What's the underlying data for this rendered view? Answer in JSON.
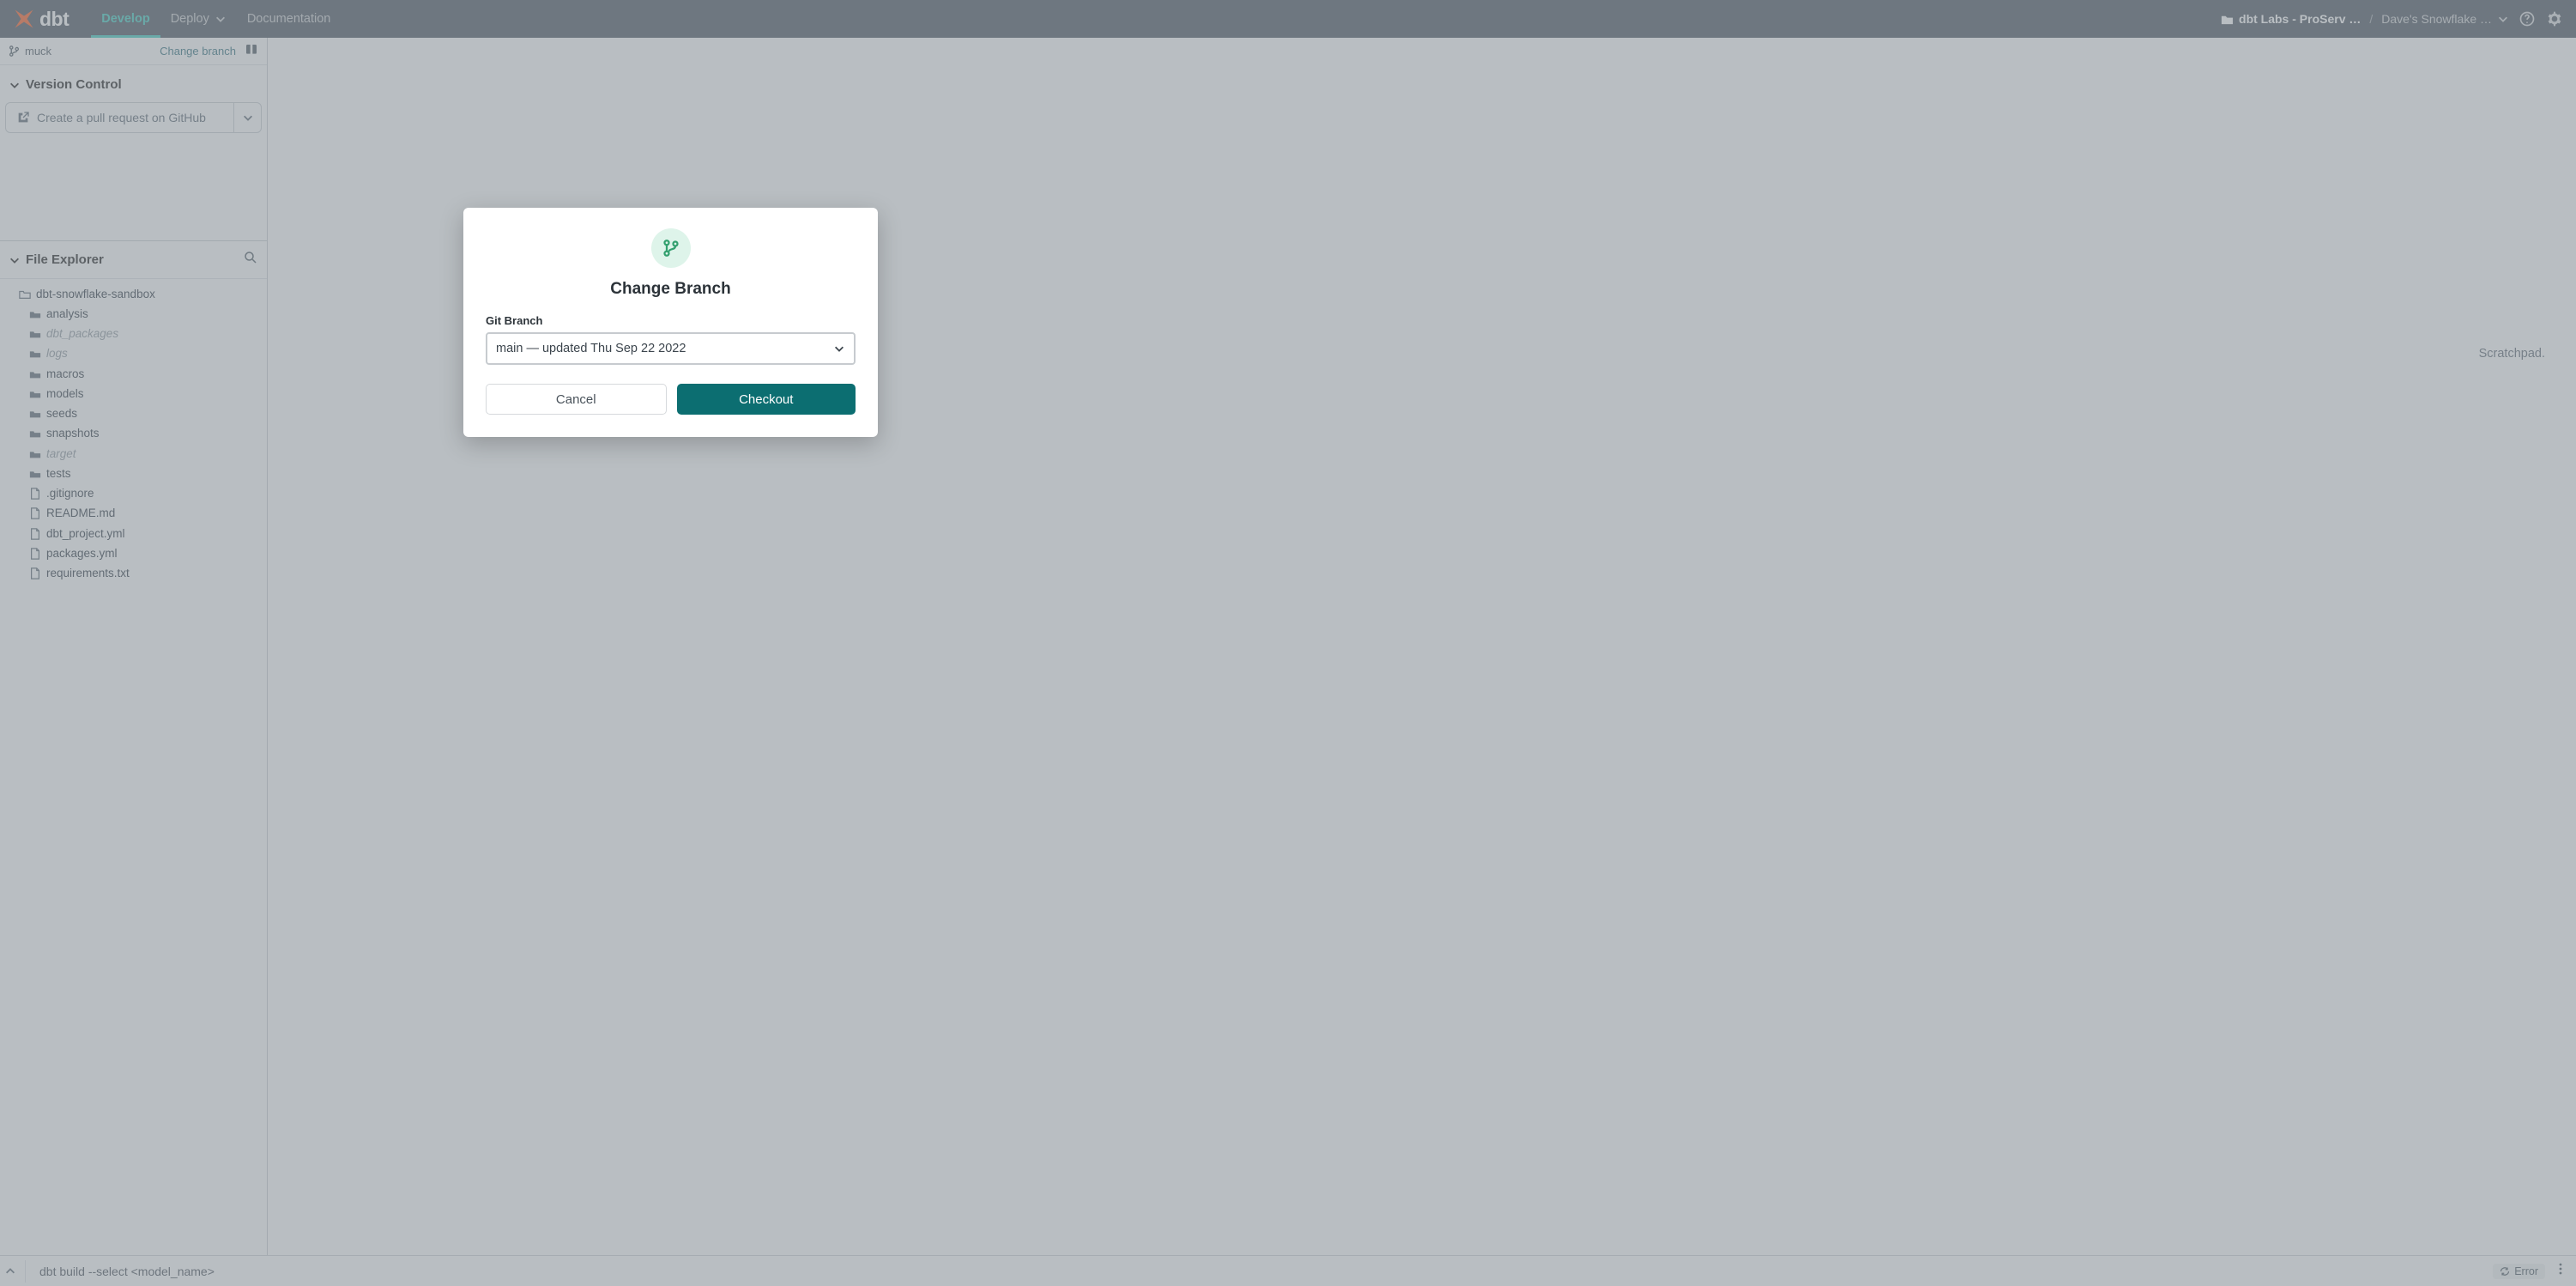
{
  "nav": {
    "logo_text": "dbt",
    "tabs": {
      "develop": "Develop",
      "deploy": "Deploy",
      "docs": "Documentation"
    },
    "org_name": "dbt Labs - ProServ …",
    "project_name": "Dave's Snowflake …",
    "separator": "/"
  },
  "branch_bar": {
    "current": "muck",
    "change_link": "Change branch"
  },
  "version_control": {
    "heading": "Version Control",
    "pr_button": "Create a pull request on GitHub"
  },
  "file_explorer": {
    "heading": "File Explorer",
    "root": "dbt-snowflake-sandbox",
    "items": [
      {
        "name": "analysis",
        "type": "folder",
        "muted": false
      },
      {
        "name": "dbt_packages",
        "type": "folder",
        "muted": true
      },
      {
        "name": "logs",
        "type": "folder",
        "muted": true
      },
      {
        "name": "macros",
        "type": "folder",
        "muted": false
      },
      {
        "name": "models",
        "type": "folder",
        "muted": false
      },
      {
        "name": "seeds",
        "type": "folder",
        "muted": false
      },
      {
        "name": "snapshots",
        "type": "folder",
        "muted": false
      },
      {
        "name": "target",
        "type": "folder",
        "muted": true
      },
      {
        "name": "tests",
        "type": "folder",
        "muted": false
      },
      {
        "name": ".gitignore",
        "type": "file",
        "muted": false
      },
      {
        "name": "README.md",
        "type": "file",
        "muted": false
      },
      {
        "name": "dbt_project.yml",
        "type": "file",
        "muted": false
      },
      {
        "name": "packages.yml",
        "type": "file",
        "muted": false
      },
      {
        "name": "requirements.txt",
        "type": "file",
        "muted": false
      }
    ]
  },
  "editor": {
    "hint_suffix": "Scratchpad."
  },
  "bottom": {
    "command": "dbt build --select <model_name>",
    "error_label": "Error"
  },
  "modal": {
    "title": "Change Branch",
    "field_label": "Git Branch",
    "selected": "main — updated Thu Sep 22 2022",
    "cancel": "Cancel",
    "confirm": "Checkout"
  }
}
